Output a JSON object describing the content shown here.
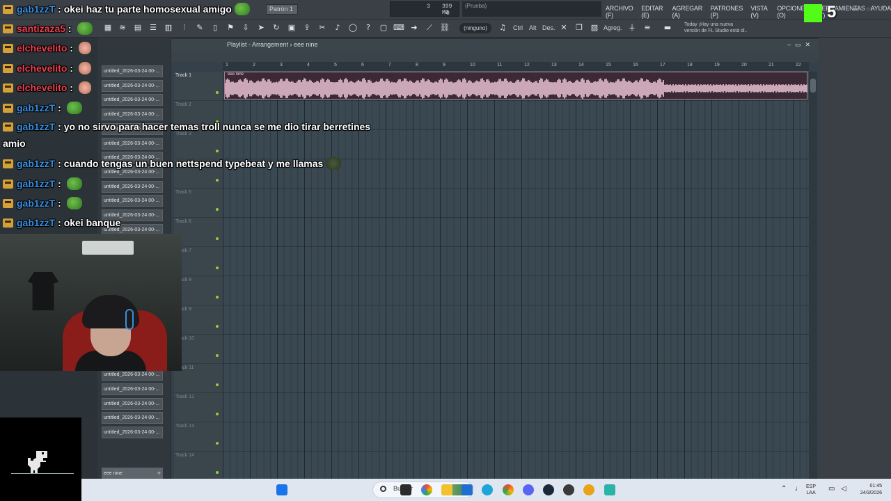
{
  "fl": {
    "menu": [
      "ARCHIVO (F)",
      "EDITAR (E)",
      "AGREGAR (A)",
      "PATRONES (P)",
      "VISTA (V)",
      "OPCIONES (O)",
      "HERRAMIENTAS (T)",
      "AYUDA"
    ],
    "pattern": "Patrón 1",
    "memory_mb": "399 MB",
    "cpu": "3",
    "polyphony": "0",
    "hint": "(Prueba)",
    "snap": "(ninguno)",
    "toolbar_labels": [
      "Ctrl",
      "Alt",
      "Des.",
      "Agreg."
    ],
    "news": [
      "Today  ¡Hay una nueva",
      "versión de FL Studio está di.."
    ],
    "kick_number": "5"
  },
  "browser": {
    "items": [
      "untitled_2026-03-24 00-...",
      "untitled_2026-03-24 00-...",
      "untitled_2026-03-24 00-...",
      "untitled_2026-03-24 00-...",
      "untitled_2026-03-24 00-...",
      "untitled_2026-03-24 00-...",
      "untitled_2026-03-24 00-...",
      "untitled_2026-03-24 00-...",
      "untitled_2026-03-24 00-...",
      "untitled_2026-03-24 00-...",
      "untitled_2026-03-24 00-...",
      "untitled_2026-03-24 00-...",
      "untitled_2026-03-24 00-...",
      "untitled_2026-03-24 00-...",
      "untitled_2026-03-24 00-...",
      "untitled_2026-03-24 00-...",
      "untitled_2026-03-24 00-..."
    ],
    "active_item": "eee nine"
  },
  "playlist": {
    "breadcrumb": "Playlist - Arrangement  ›  eee nine",
    "ruler": [
      "1",
      "2",
      "3",
      "4",
      "5",
      "6",
      "7",
      "8",
      "9",
      "10",
      "11",
      "12",
      "13",
      "14",
      "15",
      "16",
      "17",
      "18",
      "19",
      "20",
      "21",
      "22"
    ],
    "tracks": [
      "Track 1",
      "Track 2",
      "Track 3",
      "Track 4",
      "Track 5",
      "Track 6",
      "Track 7",
      "Track 8",
      "Track 9",
      "Track 10",
      "Track 11",
      "Track 12",
      "Track 13",
      "Track 14"
    ],
    "clip_name": "eee nine"
  },
  "chat": [
    {
      "user": "gab1zzT",
      "color": "#3b8fe0",
      "msg": "okei haz tu parte homosexual amigo",
      "emote": "frog"
    },
    {
      "user": "santizaza5",
      "color": "#e8414f",
      "msg": "",
      "emote": "frog"
    },
    {
      "user": "elchevelito",
      "color": "#e8414f",
      "msg": "",
      "emote": "hand"
    },
    {
      "user": "elchevelito",
      "color": "#e8414f",
      "msg": "",
      "emote": "hand"
    },
    {
      "user": "elchevelito",
      "color": "#e8414f",
      "msg": "",
      "emote": "hand"
    },
    {
      "user": "gab1zzT",
      "color": "#3b8fe0",
      "msg": "",
      "emote": "frog"
    },
    {
      "user": "gab1zzT",
      "color": "#3b8fe0",
      "msg": "yo no sirvo para hacer temas troll nunca se me dio tirar berretines",
      "emote": ""
    },
    {
      "user": "",
      "color": "#ffffff",
      "msg": "amio",
      "emote": ""
    },
    {
      "user": "gab1zzT",
      "color": "#3b8fe0",
      "msg": "cuando tengas un buen nettspend typebeat y me llamas",
      "emote": "dark"
    },
    {
      "user": "gab1zzT",
      "color": "#3b8fe0",
      "msg": "",
      "emote": "frog"
    },
    {
      "user": "gab1zzT",
      "color": "#3b8fe0",
      "msg": "",
      "emote": "frog"
    },
    {
      "user": "gab1zzT",
      "color": "#3b8fe0",
      "msg": "okei banque",
      "emote": ""
    }
  ],
  "taskbar": {
    "search_placeholder": "Buscar",
    "lang": [
      "ESP",
      "LAA"
    ],
    "time": "01:45",
    "date": "24/3/2026"
  }
}
